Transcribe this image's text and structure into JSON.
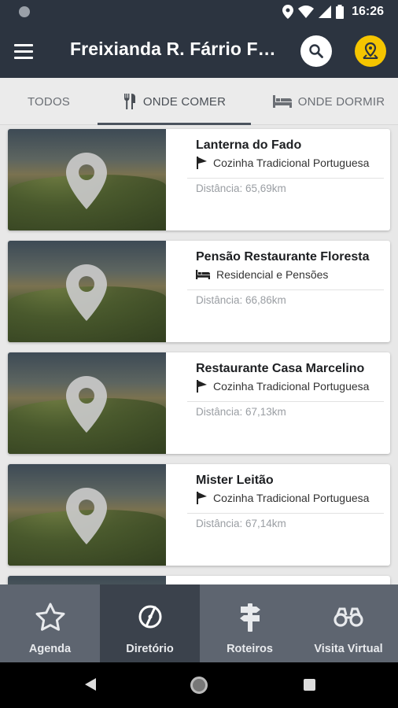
{
  "status": {
    "time": "16:26"
  },
  "appbar": {
    "title": "Freixianda R. Fárrio Fo…"
  },
  "tabs": [
    {
      "label": "TODOS"
    },
    {
      "label": "ONDE COMER"
    },
    {
      "label": "ONDE DORMIR"
    }
  ],
  "items": [
    {
      "name": "Lanterna do Fado",
      "category": "Cozinha Tradicional Portuguesa",
      "category_icon": "flag-icon",
      "distance": "Distância: 65,69km"
    },
    {
      "name": "Pensão Restaurante Floresta",
      "category": "Residencial e Pensões",
      "category_icon": "bed-icon",
      "distance": "Distância: 66,86km"
    },
    {
      "name": "Restaurante Casa Marcelino",
      "category": "Cozinha Tradicional Portuguesa",
      "category_icon": "flag-icon",
      "distance": "Distância: 67,13km"
    },
    {
      "name": "Mister Leitão",
      "category": "Cozinha Tradicional Portuguesa",
      "category_icon": "flag-icon",
      "distance": "Distância: 67,14km"
    }
  ],
  "nav": [
    {
      "label": "Agenda",
      "icon": "star-icon"
    },
    {
      "label": "Diretório",
      "icon": "compass-icon"
    },
    {
      "label": "Roteiros",
      "icon": "signpost-icon"
    },
    {
      "label": "Visita Virtual",
      "icon": "binoculars-icon"
    }
  ],
  "colors": {
    "appbar": "#2c3440",
    "accent": "#f5c500",
    "nav": "#5e6570",
    "nav_active": "#3b424c"
  }
}
